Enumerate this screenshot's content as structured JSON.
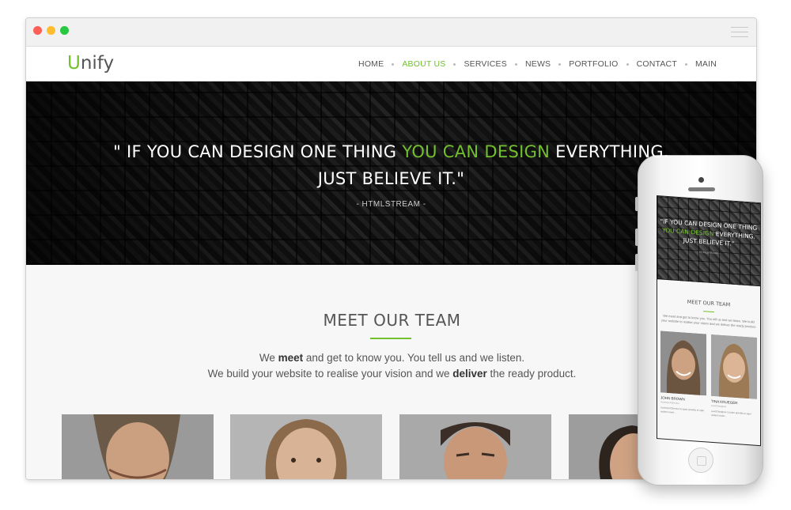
{
  "brand": {
    "logo_first": "U",
    "logo_rest": "nify",
    "accent_color": "#72c02c"
  },
  "nav": {
    "items": [
      {
        "label": "HOME"
      },
      {
        "label": "ABOUT US",
        "active": true
      },
      {
        "label": "SERVICES"
      },
      {
        "label": "NEWS"
      },
      {
        "label": "PORTFOLIO"
      },
      {
        "label": "CONTACT"
      },
      {
        "label": "MAIN"
      }
    ]
  },
  "hero": {
    "line1_a": "\" IF YOU CAN DESIGN ONE THING ",
    "line1_green": "YOU CAN DESIGN",
    "line1_b": " EVERYTHING.",
    "line2": "JUST BELIEVE IT.\"",
    "author": "- HTMLSTREAM -"
  },
  "team": {
    "title": "MEET OUR TEAM",
    "desc1_a": "We ",
    "desc1_bold": "meet",
    "desc1_b": " and get to know you. You tell us and we listen.",
    "desc2_a": "We build your website to realise your vision and we ",
    "desc2_bold": "deliver",
    "desc2_b": " the ready product."
  },
  "mobile": {
    "hero_line1": "\"IF YOU CAN DESIGN ONE THING",
    "hero_green": "YOU CAN DESIGN",
    "hero_line2b": " EVERYTHING.",
    "hero_line3": "JUST BELIEVE IT.\"",
    "author": "- HTMLSTREAM -",
    "title": "MEET OUR TEAM",
    "desc": "We meet and get to know you. You tell us and we listen. We build your website to realise your vision and we deliver the ready product.",
    "members": [
      {
        "name": "JOHN BROWN",
        "role": "Technical Director",
        "text": "Technical Director to justo gravida et eget nullam lorem..."
      },
      {
        "name": "TINA KRUEGER",
        "role": "Lead Designer",
        "text": "Lead Designer to justo gravida et eget nullam lorem..."
      }
    ]
  }
}
